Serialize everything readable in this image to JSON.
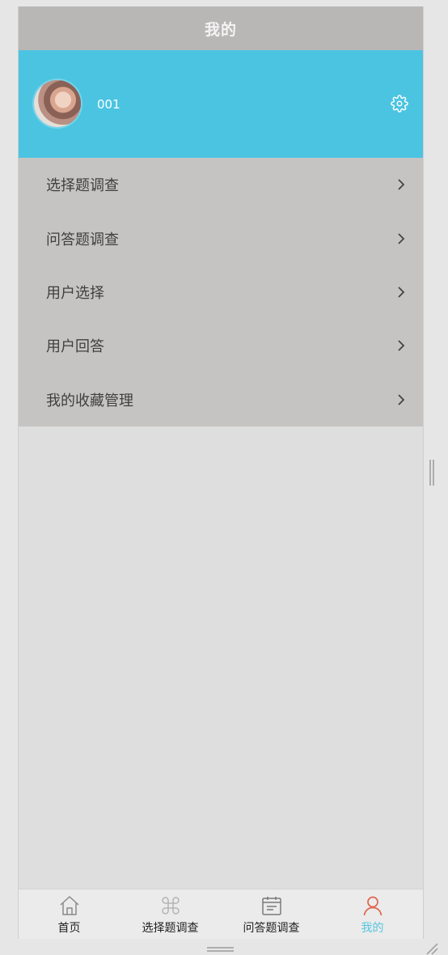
{
  "header": {
    "title": "我的"
  },
  "profile": {
    "username": "001"
  },
  "menu": {
    "items": [
      {
        "label": "选择题调查"
      },
      {
        "label": "问答题调查"
      },
      {
        "label": "用户选择"
      },
      {
        "label": "用户回答"
      },
      {
        "label": "我的收藏管理"
      }
    ]
  },
  "tabbar": {
    "tabs": [
      {
        "label": "首页",
        "icon": "home-icon"
      },
      {
        "label": "选择题调查",
        "icon": "command-icon"
      },
      {
        "label": "问答题调查",
        "icon": "calendar-icon"
      },
      {
        "label": "我的",
        "icon": "user-icon"
      }
    ],
    "active": "我的"
  },
  "colors": {
    "navbar": "#b9b6b6",
    "profile_bg": "#4bc4e1",
    "menu_bg": "#c6c4c3",
    "content_bg": "#dedede",
    "active_tab": "#55c6df",
    "user_icon": "#e0664f"
  }
}
